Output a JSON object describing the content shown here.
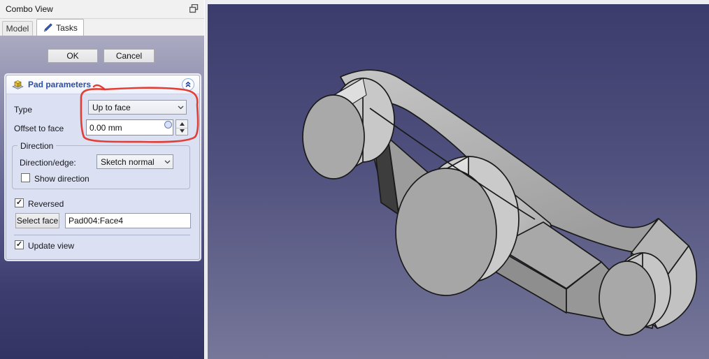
{
  "window": {
    "title": "Combo View"
  },
  "tabs": {
    "model": "Model",
    "tasks": "Tasks"
  },
  "dialog_buttons": {
    "ok": "OK",
    "cancel": "Cancel"
  },
  "pad_panel": {
    "title": "Pad parameters",
    "type_label": "Type",
    "type_value": "Up to face",
    "offset_label": "Offset to face",
    "offset_value": "0.00 mm",
    "direction_group": {
      "legend": "Direction",
      "direction_label": "Direction/edge:",
      "direction_value": "Sketch normal",
      "show_direction_label": "Show direction",
      "show_direction_checked": false
    },
    "reversed_label": "Reversed",
    "reversed_checked": true,
    "select_face_button": "Select face",
    "face_value": "Pad004:Face4",
    "update_view_label": "Update view",
    "update_view_checked": true
  },
  "icons": {
    "check": "✓"
  },
  "colors": {
    "annotation_red": "#e1352a",
    "header_blue": "#2a4fa8",
    "pad_icon_yellow": "#f2d355",
    "task_area_top": "#abaac2",
    "task_area_bottom": "#333363",
    "viewport_top": "#3b3b6c",
    "viewport_bottom": "#767799",
    "model_gray": "#a8a8a8",
    "edge_black": "#1a1a1a"
  }
}
